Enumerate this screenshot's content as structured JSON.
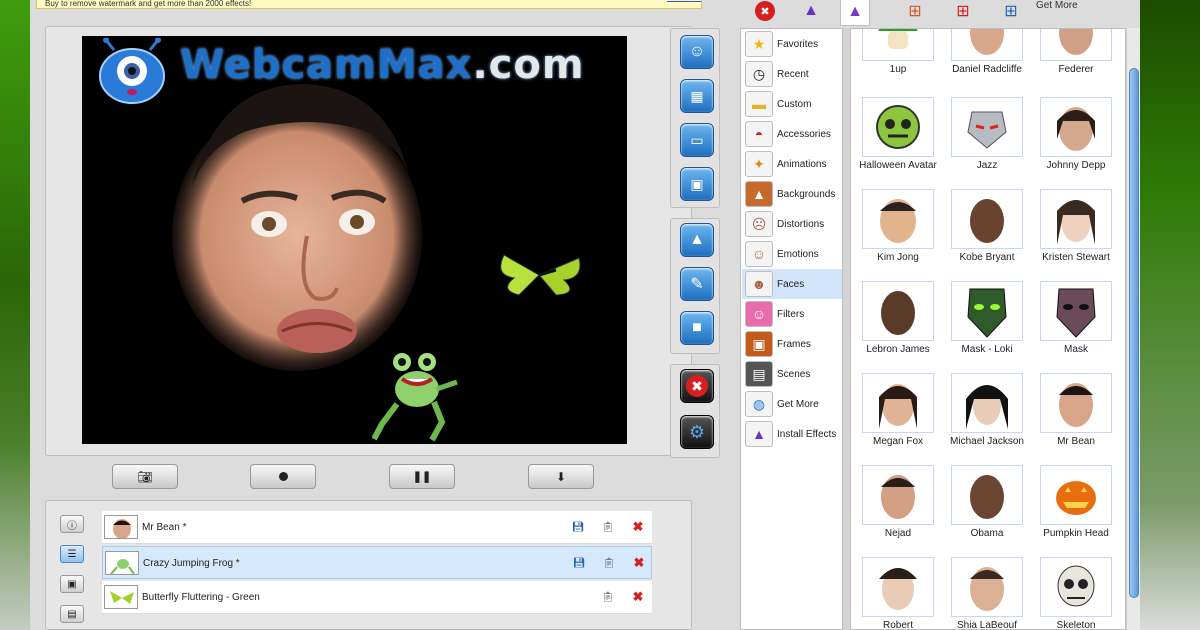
{
  "notice": {
    "text": "Buy to remove watermark and get more than 2000 effects!"
  },
  "preview": {
    "logo_text": "WebcamMax",
    "logo_suffix": ".com"
  },
  "effects_list": {
    "rows": [
      {
        "label": "Mr Bean *",
        "has_save": true
      },
      {
        "label": "Crazy Jumping Frog *",
        "has_save": true
      },
      {
        "label": "Butterfly Fluttering - Green",
        "has_save": false
      }
    ]
  },
  "toolbar": {
    "get_more": "Get More"
  },
  "categories": [
    {
      "label": "Favorites",
      "icon": "star-icon"
    },
    {
      "label": "Recent",
      "icon": "clock-icon"
    },
    {
      "label": "Custom",
      "icon": "folder-icon"
    },
    {
      "label": "Accessories",
      "icon": "cap-icon"
    },
    {
      "label": "Animations",
      "icon": "butterfly-icon"
    },
    {
      "label": "Backgrounds",
      "icon": "landscape-icon"
    },
    {
      "label": "Distortions",
      "icon": "distorted-face-icon"
    },
    {
      "label": "Emotions",
      "icon": "emotion-face-icon"
    },
    {
      "label": "Faces",
      "icon": "face-icon"
    },
    {
      "label": "Filters",
      "icon": "filter-icon"
    },
    {
      "label": "Frames",
      "icon": "frame-icon"
    },
    {
      "label": "Scenes",
      "icon": "scene-icon"
    },
    {
      "label": "Get More",
      "icon": "globe-icon"
    },
    {
      "label": "Install Effects",
      "icon": "wizard-hat-icon"
    }
  ],
  "active_category": "Faces",
  "faces": [
    {
      "label": "1up"
    },
    {
      "label": "Daniel Radcliffe"
    },
    {
      "label": "Federer"
    },
    {
      "label": "Halloween Avatar"
    },
    {
      "label": "Jazz"
    },
    {
      "label": "Johnny Depp"
    },
    {
      "label": "Kim Jong"
    },
    {
      "label": "Kobe Bryant"
    },
    {
      "label": "Kristen Stewart"
    },
    {
      "label": "Lebron James"
    },
    {
      "label": "Mask - Loki"
    },
    {
      "label": "Mask"
    },
    {
      "label": "Megan Fox"
    },
    {
      "label": "Michael Jackson"
    },
    {
      "label": "Mr Bean"
    },
    {
      "label": "Nejad"
    },
    {
      "label": "Obama"
    },
    {
      "label": "Pumpkin Head"
    },
    {
      "label": "Robert"
    },
    {
      "label": "Shia LaBeouf"
    },
    {
      "label": "Skeleton"
    }
  ],
  "colors": {
    "accent": "#1e6fc8",
    "selected_row": "#d6e8fb",
    "delete_red": "#d62020"
  }
}
